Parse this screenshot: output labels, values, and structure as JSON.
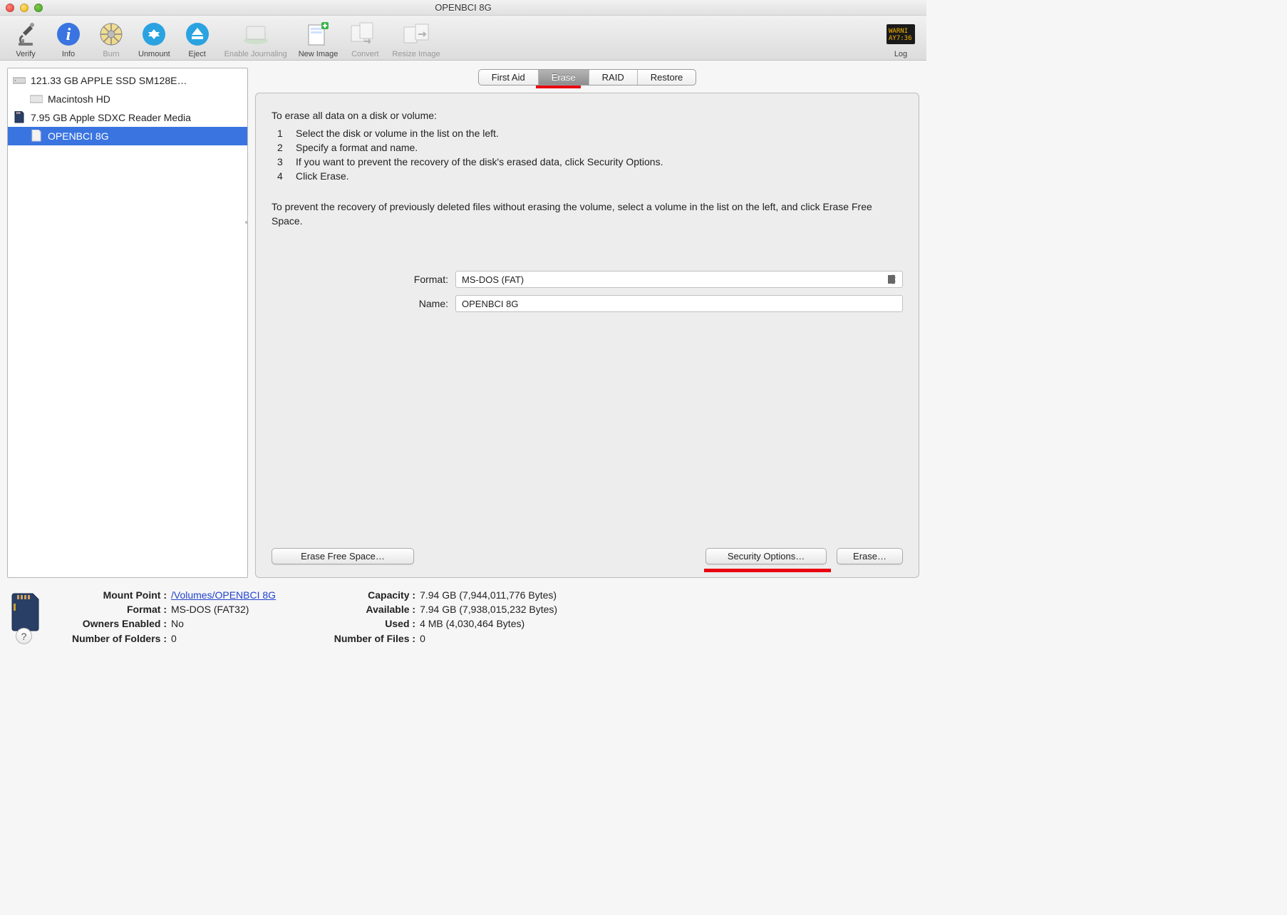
{
  "window": {
    "title": "OPENBCI 8G"
  },
  "toolbar": {
    "verify": "Verify",
    "info": "Info",
    "burn": "Burn",
    "unmount": "Unmount",
    "eject": "Eject",
    "enable_journaling": "Enable Journaling",
    "new_image": "New Image",
    "convert": "Convert",
    "resize_image": "Resize Image",
    "log": "Log"
  },
  "sidebar": {
    "items": [
      {
        "label": "121.33 GB APPLE SSD SM128E…",
        "level": 0,
        "type": "disk"
      },
      {
        "label": "Macintosh HD",
        "level": 1,
        "type": "volume"
      },
      {
        "label": "7.95 GB Apple SDXC Reader Media",
        "level": 0,
        "type": "sd-reader"
      },
      {
        "label": "OPENBCI 8G",
        "level": 1,
        "type": "sd-volume",
        "selected": true
      }
    ]
  },
  "tabs": {
    "items": [
      "First Aid",
      "Erase",
      "RAID",
      "Restore"
    ],
    "active_index": 1
  },
  "erase_panel": {
    "intro": "To erase all data on a disk or volume:",
    "steps": [
      "Select the disk or volume in the list on the left.",
      "Specify a format and name.",
      "If you want to prevent the recovery of the disk's erased data, click Security Options.",
      "Click Erase."
    ],
    "para2": "To prevent the recovery of previously deleted files without erasing the volume, select a volume in the list on the left, and click Erase Free Space.",
    "format_label": "Format:",
    "format_value": "MS-DOS (FAT)",
    "name_label": "Name:",
    "name_value": "OPENBCI 8G",
    "btn_erase_free_space": "Erase Free Space…",
    "btn_security_options": "Security Options…",
    "btn_erase": "Erase…"
  },
  "info": {
    "mount_point_label": "Mount Point :",
    "mount_point_value": "/Volumes/OPENBCI 8G",
    "format_label": "Format :",
    "format_value": "MS-DOS (FAT32)",
    "owners_enabled_label": "Owners Enabled :",
    "owners_enabled_value": "No",
    "num_folders_label": "Number of Folders :",
    "num_folders_value": "0",
    "capacity_label": "Capacity :",
    "capacity_value": "7.94 GB (7,944,011,776 Bytes)",
    "available_label": "Available :",
    "available_value": "7.94 GB (7,938,015,232 Bytes)",
    "used_label": "Used :",
    "used_value": "4 MB (4,030,464 Bytes)",
    "num_files_label": "Number of Files :",
    "num_files_value": "0"
  }
}
